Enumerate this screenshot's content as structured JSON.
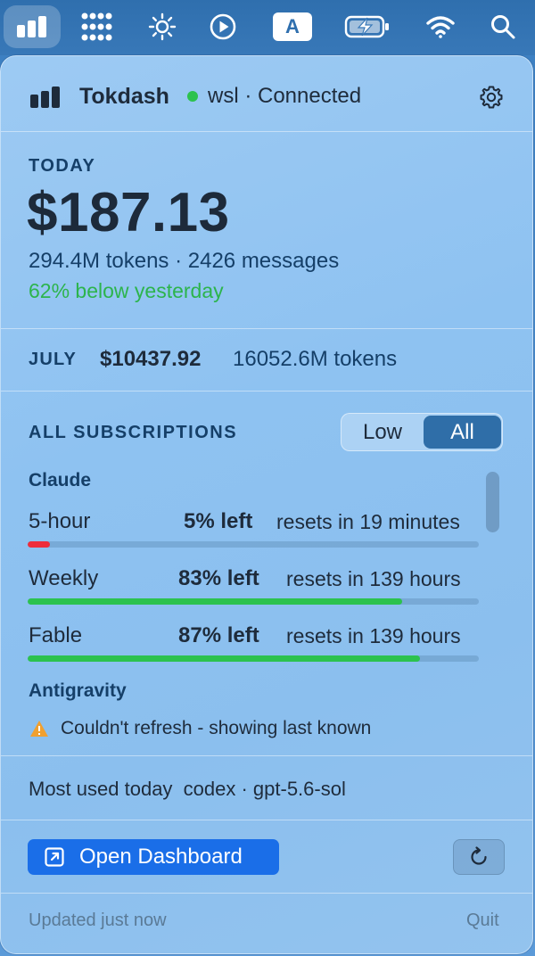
{
  "menubar": {
    "icons": [
      "tokdash-bars-icon",
      "grid-dots-icon",
      "brightness-icon",
      "play-icon",
      "input-source-icon",
      "battery-charging-icon",
      "wifi-icon",
      "search-icon"
    ],
    "input_letter": "A"
  },
  "header": {
    "app_name": "Tokdash",
    "status": "wsl · Connected",
    "status_color": "#2cc24e"
  },
  "today": {
    "label": "TODAY",
    "amount": "$187.13",
    "tokens_messages": "294.4M tokens · 2426 messages",
    "delta": "62% below yesterday",
    "delta_color": "#2cb44c"
  },
  "month": {
    "label": "JULY",
    "amount": "$10437.92",
    "tokens": "16052.6M tokens"
  },
  "subscriptions": {
    "label": "ALL SUBSCRIPTIONS",
    "filter_options": [
      "Low",
      "All"
    ],
    "filter_selected": "All",
    "providers": [
      {
        "name": "Claude",
        "limits": [
          {
            "name": "5-hour",
            "left": "5% left",
            "resets": "resets in 19 minutes",
            "fraction": 0.05,
            "color": "#ee2d3c"
          },
          {
            "name": "Weekly",
            "left": "83% left",
            "resets": "resets in 139 hours",
            "fraction": 0.83,
            "color": "#2cc24e"
          },
          {
            "name": "Fable",
            "left": "87% left",
            "resets": "resets in 139 hours",
            "fraction": 0.87,
            "color": "#2cc24e"
          }
        ]
      },
      {
        "name": "Antigravity",
        "warning": "Couldn't refresh - showing last known"
      }
    ]
  },
  "most_used": {
    "text": "Most used today  codex · gpt-5.6-sol"
  },
  "actions": {
    "open_dashboard": "Open Dashboard",
    "accent": "#1a6ee8"
  },
  "footer": {
    "updated": "Updated just now",
    "quit": "Quit"
  }
}
